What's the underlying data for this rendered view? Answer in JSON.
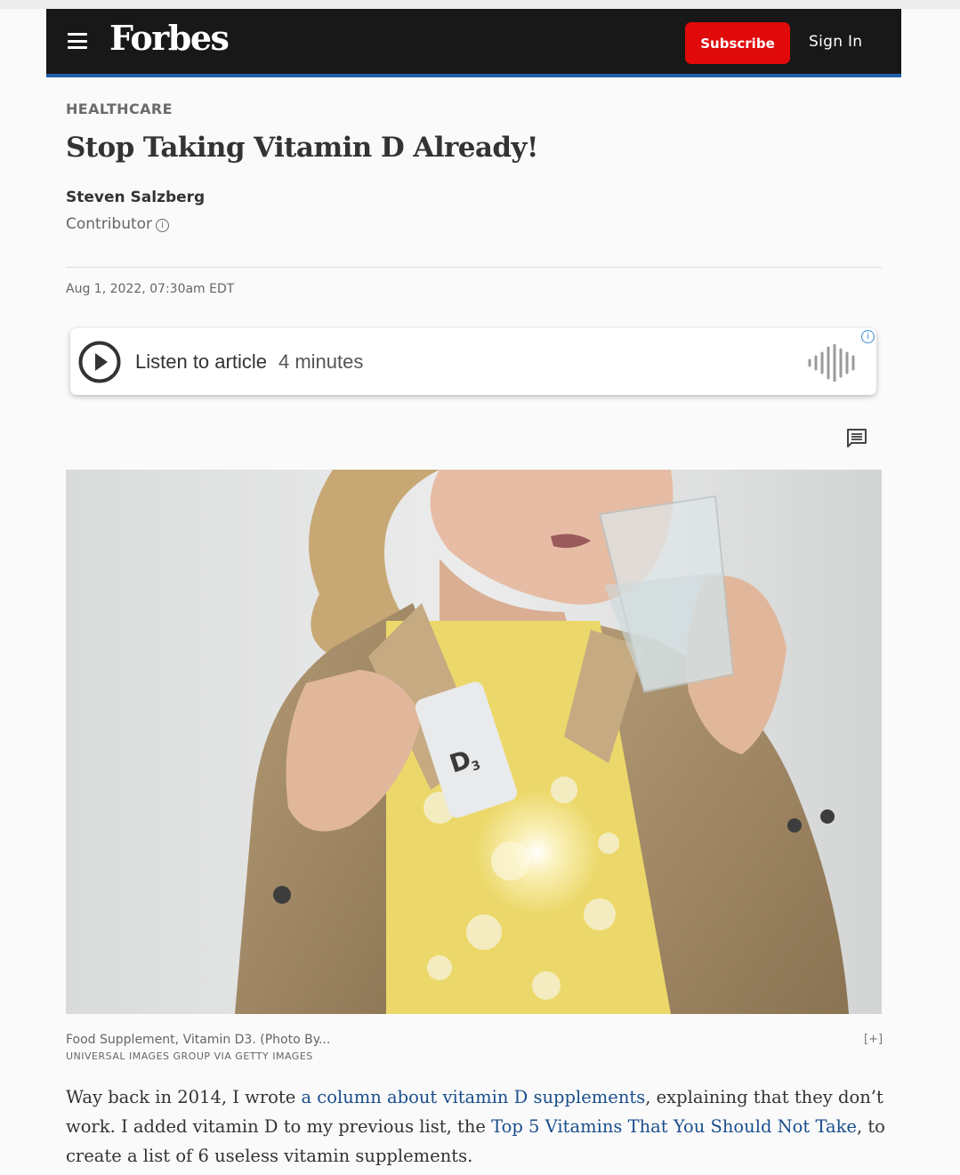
{
  "header": {
    "logo": "Forbes",
    "subscribe_label": "Subscribe",
    "signin_label": "Sign In"
  },
  "article": {
    "section": "HEALTHCARE",
    "title": "Stop Taking Vitamin D Already!",
    "author": "Steven Salzberg",
    "role": "Contributor",
    "date": "Aug 1, 2022, 07:30am EDT"
  },
  "audio_player": {
    "listen_label": "Listen to article",
    "duration": "4 minutes"
  },
  "image": {
    "caption": "Food Supplement, Vitamin D3. (Photo By...",
    "credit": "UNIVERSAL IMAGES GROUP VIA GETTY IMAGES",
    "expand_label": "[+]",
    "bottle_label": "D",
    "bottle_subscript": "3"
  },
  "body": {
    "p1_part1": "Way back in 2014, I wrote ",
    "p1_link1": "a column about vitamin D supplements",
    "p1_part2": ", explaining that they don’t work. I added vitamin D to my previous list, the ",
    "p1_link2": "Top 5 Vitamins That You Should Not Take",
    "p1_part3": ", to create a list of 6 useless vitamin supplements."
  },
  "colors": {
    "header_bg": "#181818",
    "header_accent": "#1f5ea8",
    "subscribe_bg": "#e00a0a",
    "link": "#1a4e8c"
  },
  "icons": [
    "menu-icon",
    "info-icon",
    "play-icon",
    "waveform-icon",
    "comment-icon"
  ]
}
